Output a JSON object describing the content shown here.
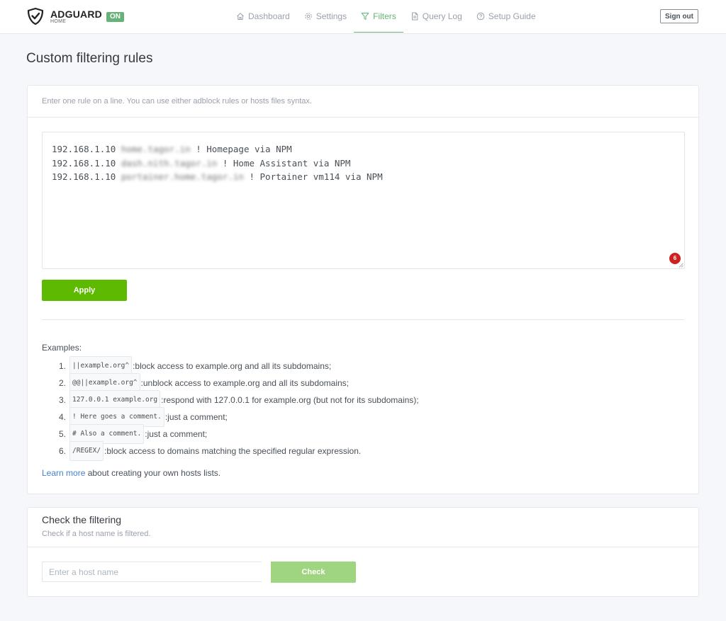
{
  "brand": {
    "name": "ADGUARD",
    "sub": "HOME",
    "status": "ON"
  },
  "nav": {
    "items": [
      {
        "label": "Dashboard",
        "icon": "home-icon"
      },
      {
        "label": "Settings",
        "icon": "gear-icon"
      },
      {
        "label": "Filters",
        "icon": "filter-icon",
        "active": true
      },
      {
        "label": "Query Log",
        "icon": "document-icon"
      },
      {
        "label": "Setup Guide",
        "icon": "help-circle-icon"
      }
    ],
    "signout": "Sign out"
  },
  "page": {
    "title": "Custom filtering rules"
  },
  "rules_card": {
    "description": "Enter one rule on a line. You can use either adblock rules or hosts files syntax.",
    "rules": [
      {
        "ip": "192.168.1.10",
        "host": "home.tagor.in",
        "comment": "! Homepage via NPM"
      },
      {
        "ip": "192.168.1.10",
        "host": "dash.nith.tagor.in",
        "comment": "! Home Assistant via NPM"
      },
      {
        "ip": "192.168.1.10",
        "host": "portainer.home.tagor.in",
        "comment": "! Portainer vm114 via NPM"
      }
    ],
    "line_count": "6",
    "apply_label": "Apply",
    "examples_title": "Examples:",
    "examples": [
      {
        "num": "1.",
        "code": "||example.org^",
        "text": ":block access to example.org and all its subdomains;"
      },
      {
        "num": "2.",
        "code": "@@||example.org^",
        "text": ":unblock access to example.org and all its subdomains;"
      },
      {
        "num": "3.",
        "code": "127.0.0.1 example.org",
        "text": ":respond with 127.0.0.1 for example.org (but not for its subdomains);"
      },
      {
        "num": "4.",
        "code": "! Here goes a comment.",
        "text": ":just a comment;"
      },
      {
        "num": "5.",
        "code": "# Also a comment.",
        "text": ":just a comment;"
      },
      {
        "num": "6.",
        "code": "/REGEX/",
        "text": ":block access to domains matching the specified regular expression."
      }
    ],
    "learn_more_link": "Learn more",
    "learn_more_text": " about creating your own hosts lists."
  },
  "check_card": {
    "title": "Check the filtering",
    "subtitle": "Check if a host name is filtered.",
    "placeholder": "Enter a host name",
    "value": "",
    "button": "Check"
  },
  "colors": {
    "accent": "#66b574",
    "apply_button": "#5eba00",
    "check_button": "#9fd580",
    "badge": "#cd201f",
    "link": "#467fcf"
  }
}
